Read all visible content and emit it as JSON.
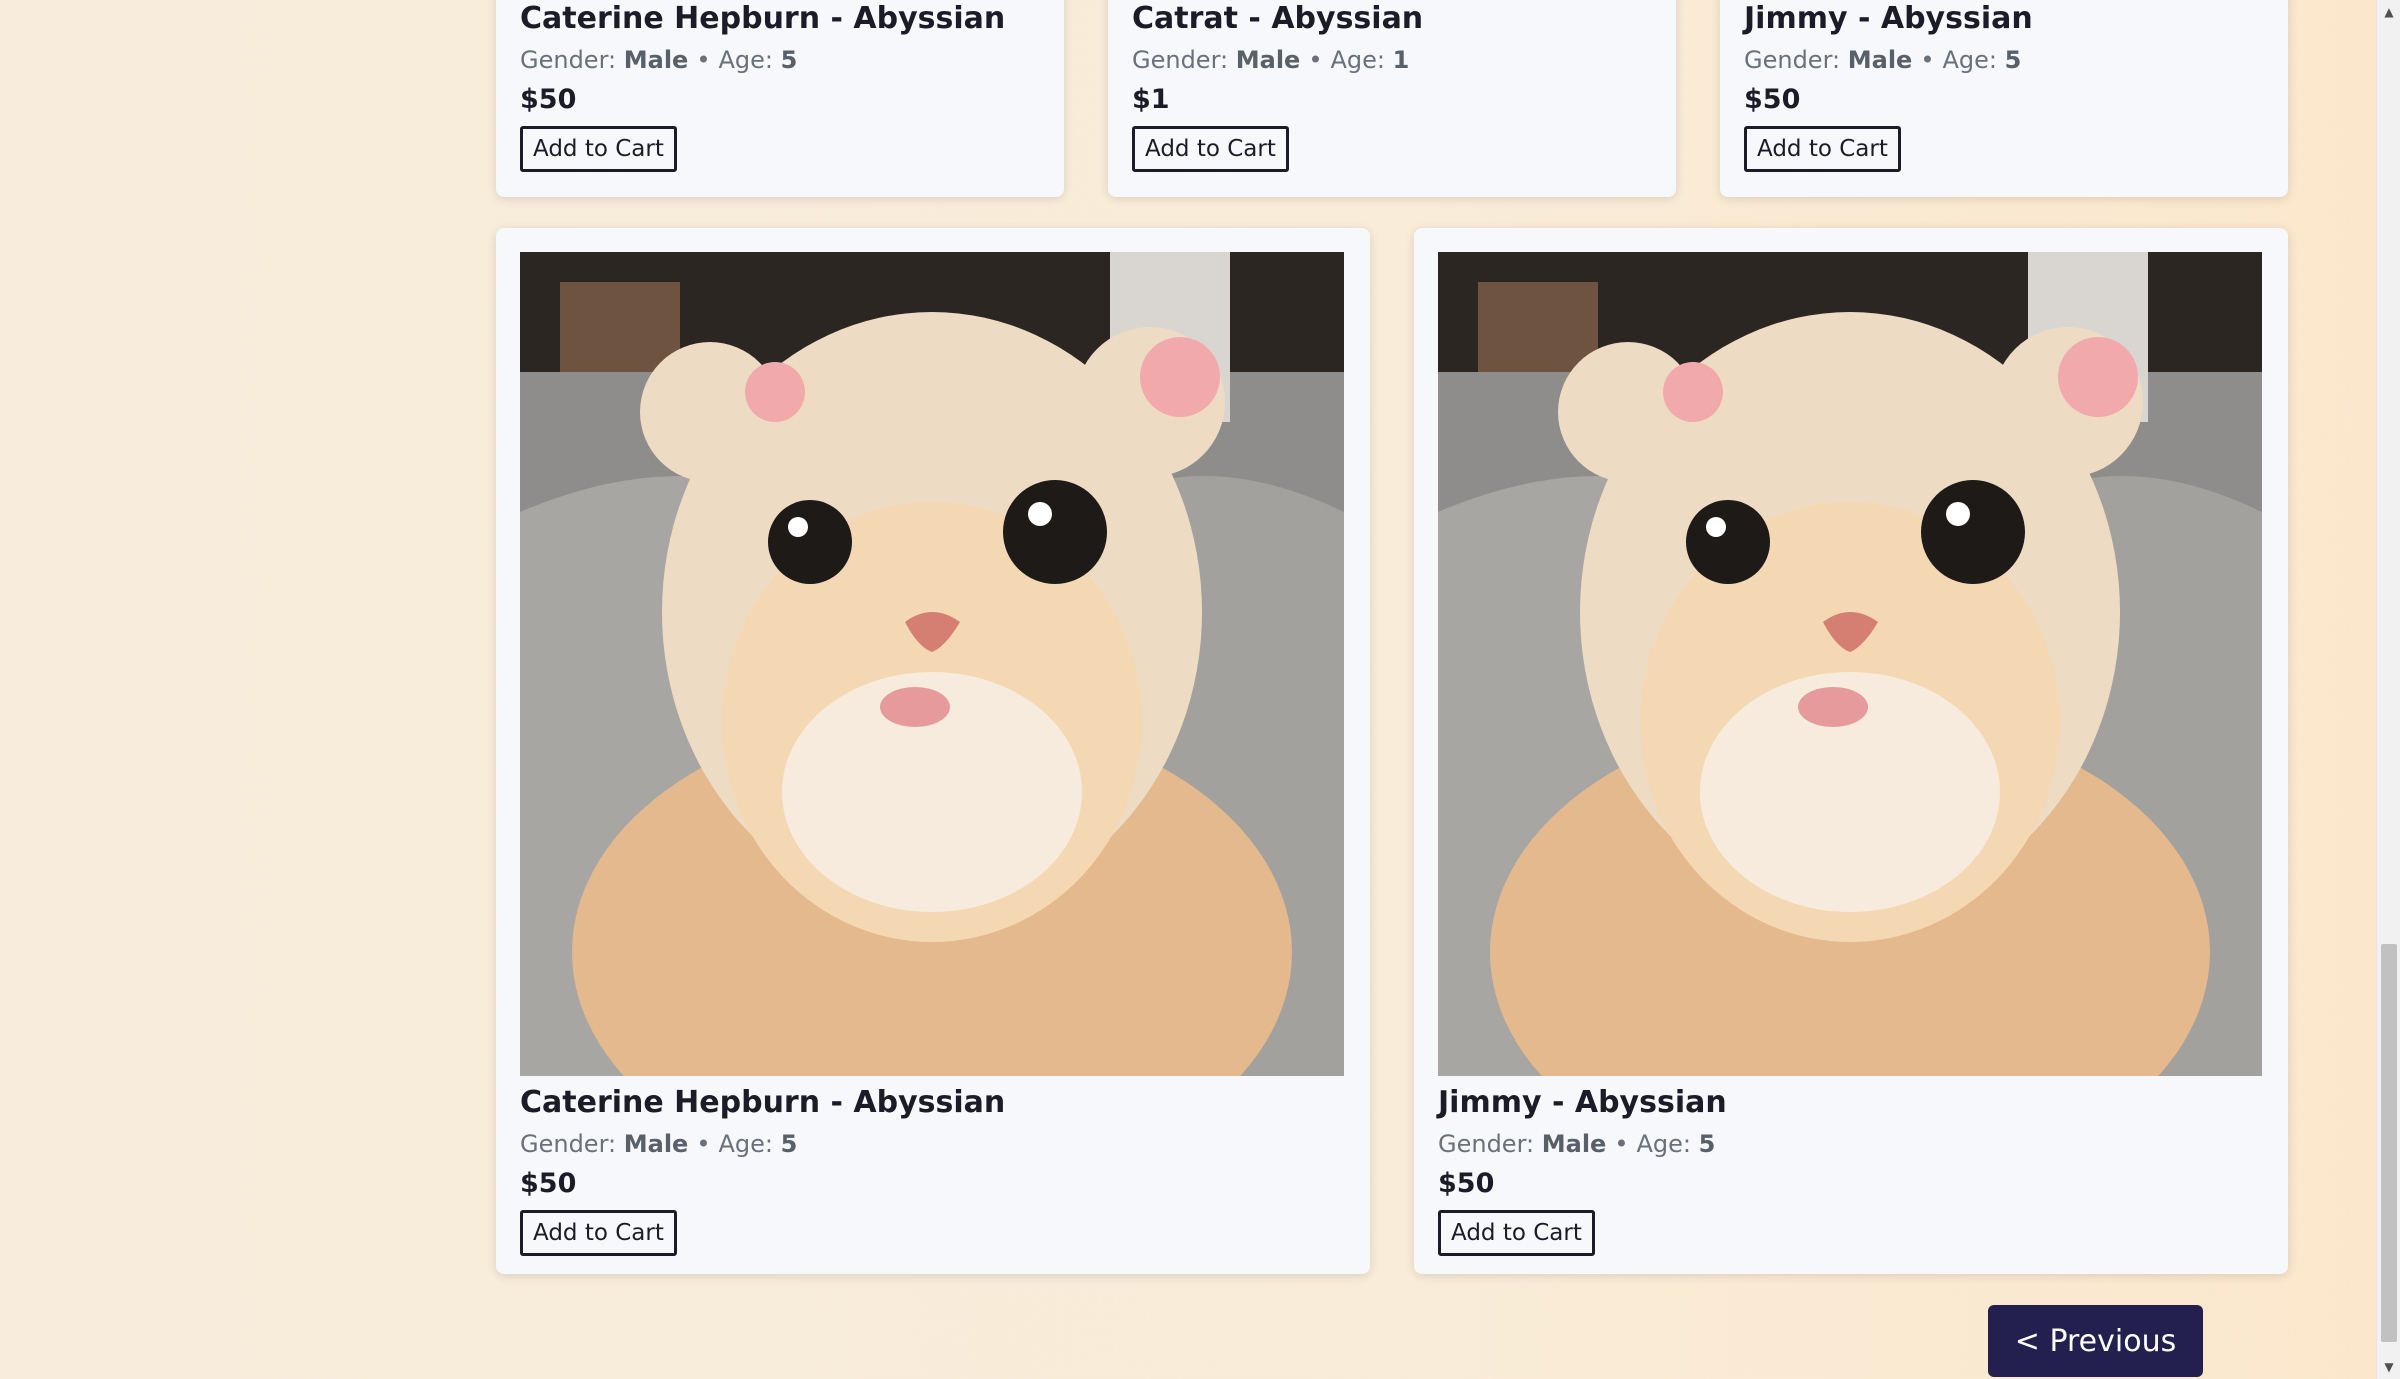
{
  "top_row": [
    {
      "name": "Caterine Hepburn - Abyssian",
      "gender_label": "Gender:",
      "gender": "Male",
      "age_label": "Age:",
      "age": "5",
      "price": "$50",
      "button": "Add to Cart"
    },
    {
      "name": "Catrat - Abyssian",
      "gender_label": "Gender:",
      "gender": "Male",
      "age_label": "Age:",
      "age": "1",
      "price": "$1",
      "button": "Add to Cart"
    },
    {
      "name": "Jimmy - Abyssian",
      "gender_label": "Gender:",
      "gender": "Male",
      "age_label": "Age:",
      "age": "5",
      "price": "$50",
      "button": "Add to Cart"
    }
  ],
  "bottom_row": [
    {
      "name": "Caterine Hepburn - Abyssian",
      "gender_label": "Gender:",
      "gender": "Male",
      "age_label": "Age:",
      "age": "5",
      "price": "$50",
      "button": "Add to Cart"
    },
    {
      "name": "Jimmy - Abyssian",
      "gender_label": "Gender:",
      "gender": "Male",
      "age_label": "Age:",
      "age": "5",
      "price": "$50",
      "button": "Add to Cart"
    }
  ],
  "separator": "•",
  "pagination": {
    "previous_label": "< Previous"
  },
  "colors": {
    "button_bg": "#23204f",
    "card_bg": "#f6f8fb",
    "page_bg": "#f8ecdc"
  },
  "icons": {
    "photo": "cat-photo",
    "scroll_up": "triangle-up-icon",
    "scroll_down": "triangle-down-icon"
  }
}
